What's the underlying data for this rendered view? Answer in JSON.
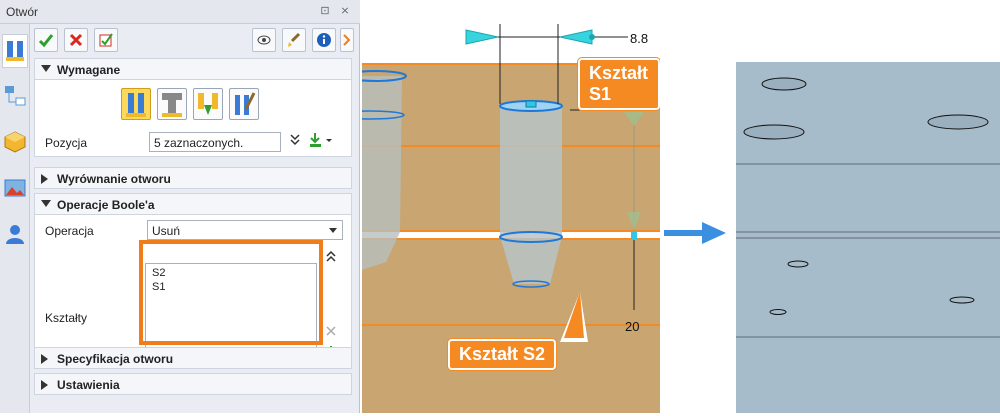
{
  "dialog": {
    "title": "Otwór",
    "pin_icon": "⊡",
    "close_icon": "⨯"
  },
  "sections": {
    "required": "Wymagane",
    "alignment": "Wyrównanie otworu",
    "boolean": "Operacje Boole'a",
    "spec": "Specyfikacja otworu",
    "settings": "Ustawienia"
  },
  "position": {
    "label": "Pozycja",
    "value": "5 zaznaczonych."
  },
  "boolean_op": {
    "operation_label": "Operacja",
    "operation_value": "Usuń",
    "shapes_label": "Kształty",
    "shapes": [
      "S2",
      "S1"
    ]
  },
  "view": {
    "callout_s1": "Kształt S1",
    "callout_s2": "Kształt S2",
    "dim_top": "8.8",
    "dim_depth": "20"
  },
  "colors": {
    "accent_orange": "#f58a23",
    "ok_green": "#2e9e2e",
    "cancel_red": "#d9281c",
    "model_tan": "#c8a571",
    "result_blue": "#a6bccb",
    "arrow_blue": "#3a8fe0"
  }
}
